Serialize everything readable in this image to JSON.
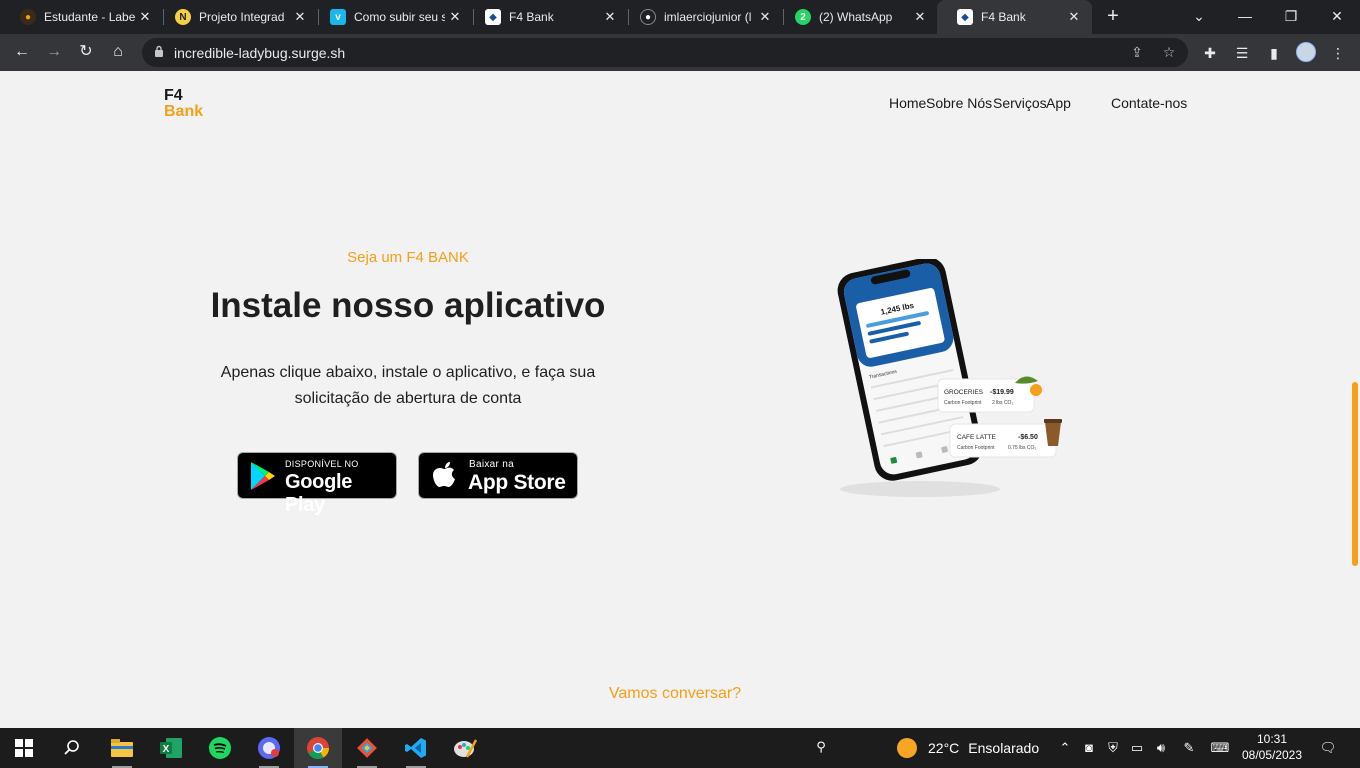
{
  "browser": {
    "tabs": [
      {
        "title": "Estudante - Labe",
        "icon": "labenu-icon",
        "active": false
      },
      {
        "title": "Projeto Integrad",
        "icon": "notion-icon",
        "active": false
      },
      {
        "title": "Como subir seu s",
        "icon": "vimeo-icon",
        "active": false
      },
      {
        "title": "F4 Bank",
        "icon": "f4bank-icon",
        "active": false
      },
      {
        "title": "imlaerciojunior (l",
        "icon": "github-icon",
        "active": false
      },
      {
        "title": "(2) WhatsApp",
        "icon": "whatsapp-icon",
        "active": false
      },
      {
        "title": "F4 Bank",
        "icon": "f4bank-icon",
        "active": true
      }
    ],
    "whatsapp_badge": "2",
    "url": "incredible-ladybug.surge.sh"
  },
  "site": {
    "logo_line1": "F4",
    "logo_line2": "Bank",
    "nav": [
      "Home",
      "Sobre Nós",
      "Serviços",
      "App"
    ],
    "contact_link": "Contate-nos"
  },
  "hero": {
    "eyebrow": "Seja um F4 BANK",
    "title": "Instale nosso aplicativo",
    "description": "Apenas clique abaixo, instale o aplicativo, e faça sua solicitação de abertura de conta",
    "google_play": {
      "small": "DISPONÍVEL NO",
      "big": "Google Play"
    },
    "app_store": {
      "small": "Baixar na",
      "big": "App Store"
    }
  },
  "phone_mockup": {
    "balance": "1,245 lbs",
    "card1": {
      "label": "GROCERIES",
      "amount": "-$19.99",
      "sub_label": "Carbon Footprint",
      "sub_value": "2 lbs CO₂"
    },
    "card2": {
      "label": "CAFE LATTE",
      "amount": "-$6.50",
      "sub_label": "Carbon Footprint",
      "sub_value": "0.75 lbs CO₂"
    },
    "list_title": "Transactions"
  },
  "cta": "Vamos conversar?",
  "taskbar": {
    "weather_temp": "22°C",
    "weather_desc": "Ensolarado",
    "time": "10:31",
    "date": "08/05/2023"
  },
  "colors": {
    "accent": "#f4a01a",
    "browser_dark": "#202124",
    "browser_toolbar": "#35363a",
    "page_bg": "#f2f2f2"
  }
}
